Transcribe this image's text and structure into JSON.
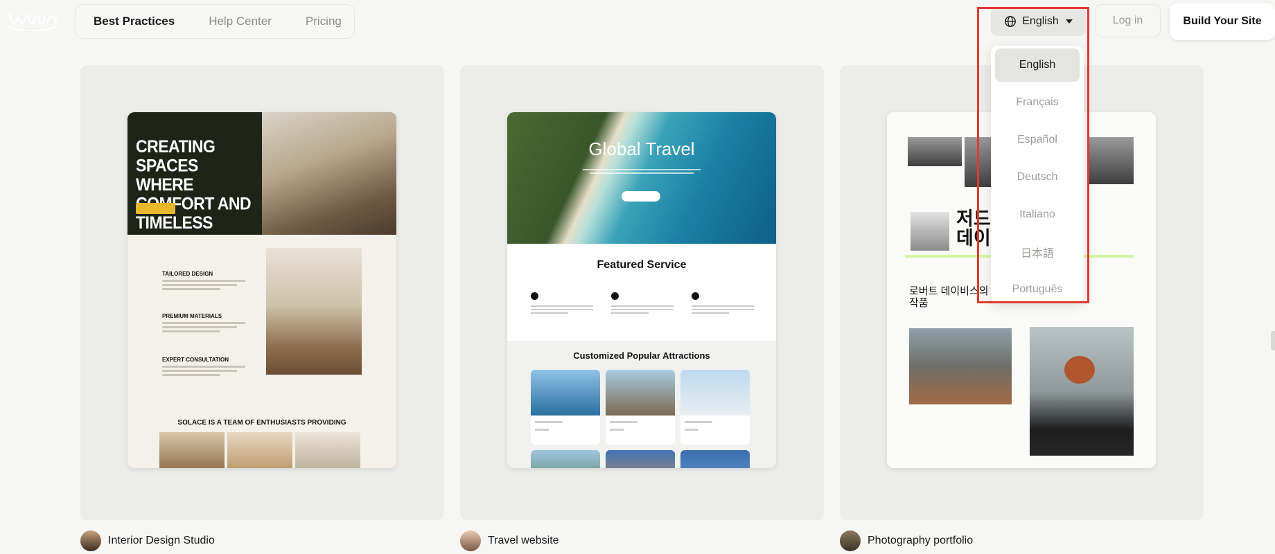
{
  "header": {
    "nav": [
      "Best Practices",
      "Help Center",
      "Pricing"
    ],
    "active_nav": "Best Practices",
    "language_button": "English",
    "login": "Log in",
    "cta": "Build Your Site"
  },
  "language_menu": {
    "options": [
      "English",
      "Français",
      "Español",
      "Deutsch",
      "Italiano",
      "日本語",
      "Português"
    ],
    "selected": "English"
  },
  "cards": [
    {
      "title": "Interior Design Studio",
      "preview": {
        "hero_title": "CREATING SPACES WHERE COMFORT AND TIMELESS",
        "sections": [
          "TAILORED DESIGN",
          "PREMIUM MATERIALS",
          "EXPERT CONSULTATION"
        ],
        "heading": "SOLACE IS A TEAM OF ENTHUSIASTS PROVIDING"
      }
    },
    {
      "title": "Travel website",
      "preview": {
        "hero_title": "Global Travel",
        "featured": "Featured Service",
        "attractions": "Customized Popular Attractions"
      }
    },
    {
      "title": "Photography portfolio",
      "preview": {
        "name": "저드\n데이",
        "subtitle": "로버트 데이비스의\n작품"
      }
    }
  ],
  "colors": {
    "accent_highlight": "#e03a2f",
    "lime_rule": "#d6f7a2",
    "interior_cta": "#e8b72c"
  }
}
